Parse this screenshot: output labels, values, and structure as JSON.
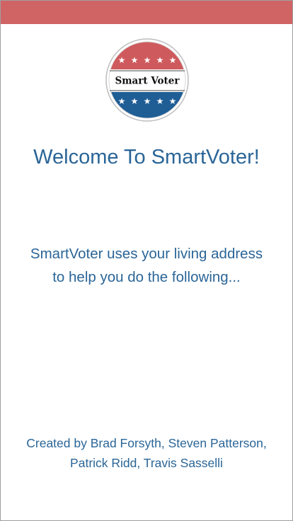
{
  "status_bar": {
    "color": "#d06464"
  },
  "logo": {
    "text": "Smart Voter",
    "star_glyph": "★",
    "colors": {
      "red": "#cf5a5d",
      "blue": "#1f5d95",
      "ring": "#bdbdbd"
    }
  },
  "welcome": {
    "title": "Welcome To SmartVoter!",
    "description": "SmartVoter uses your living address to help you do the following..."
  },
  "credits": {
    "line1": "Created by Brad Forsyth, Steven Patterson,",
    "line2": "Patrick Ridd, Travis Sasselli"
  },
  "theme": {
    "text_color": "#2a6597",
    "background": "#ffffff"
  }
}
